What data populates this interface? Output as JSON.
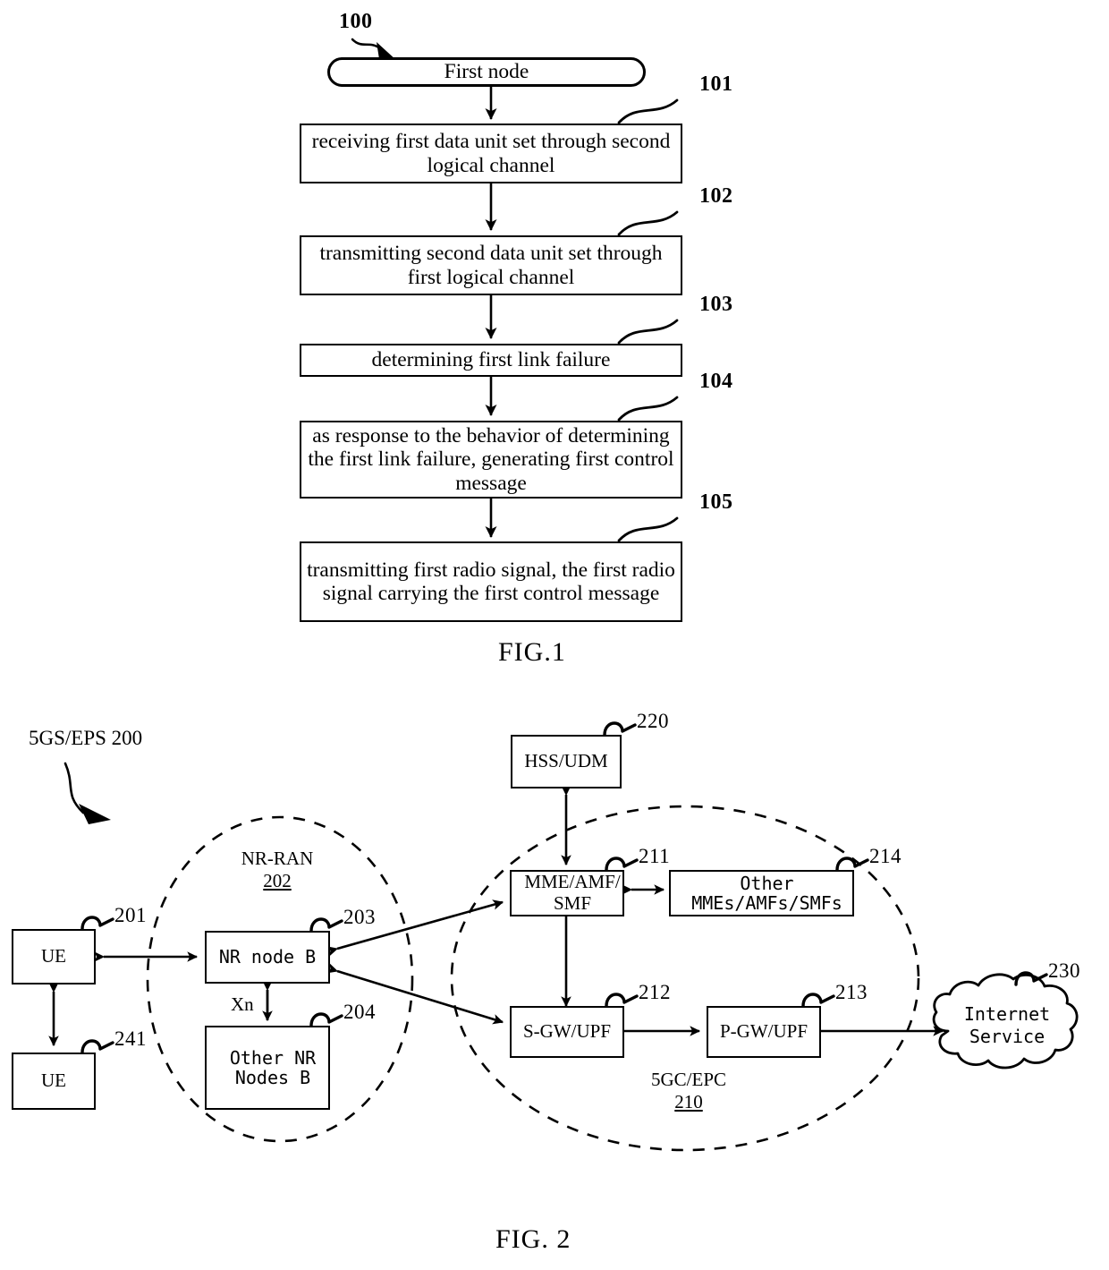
{
  "figure1": {
    "caption": "FIG.1",
    "start_ref": "100",
    "start_node": "First node",
    "steps": [
      {
        "ref": "101",
        "text": "receiving first data unit set through second logical channel"
      },
      {
        "ref": "102",
        "text": "transmitting second data unit set through first logical channel"
      },
      {
        "ref": "103",
        "text": "determining first link failure"
      },
      {
        "ref": "104",
        "text": "as response to the behavior of determining the first link failure, generating first control message"
      },
      {
        "ref": "105",
        "text": "transmitting first radio signal, the first radio signal carrying the first control message"
      }
    ]
  },
  "figure2": {
    "caption": "FIG. 2",
    "system_label": "5GS/EPS  200",
    "groups": {
      "ran": {
        "name": "NR-RAN",
        "ref": "202"
      },
      "core": {
        "name": "5GC/EPC",
        "ref": "210"
      }
    },
    "nodes": {
      "ue1": {
        "label": "UE",
        "ref": "201"
      },
      "ue2": {
        "label": "UE",
        "ref": "241"
      },
      "nr_node_b": {
        "label": "NR  node  B",
        "ref": "203"
      },
      "other_nr_nodes_b": {
        "label": "Other NR\nNodes B",
        "line1": "Other NR",
        "line2": "Nodes B",
        "ref": "204"
      },
      "hss_udm": {
        "label": "HSS/UDM",
        "ref": "220"
      },
      "mme_amf_smf": {
        "line1": "MME/AMF/",
        "line2": "SMF",
        "ref": "211"
      },
      "other_mmes": {
        "line1": "Other",
        "line2": "MMEs/AMFs/SMFs",
        "ref": "214"
      },
      "s_gw_upf": {
        "label": "S-GW/UPF",
        "ref": "212"
      },
      "p_gw_upf": {
        "label": "P-GW/UPF",
        "ref": "213"
      },
      "internet": {
        "line1": "Internet",
        "line2": "Service",
        "ref": "230"
      }
    },
    "edges": {
      "xn": "Xn"
    }
  },
  "colors": {
    "ink": "#000000",
    "paper": "#ffffff"
  }
}
